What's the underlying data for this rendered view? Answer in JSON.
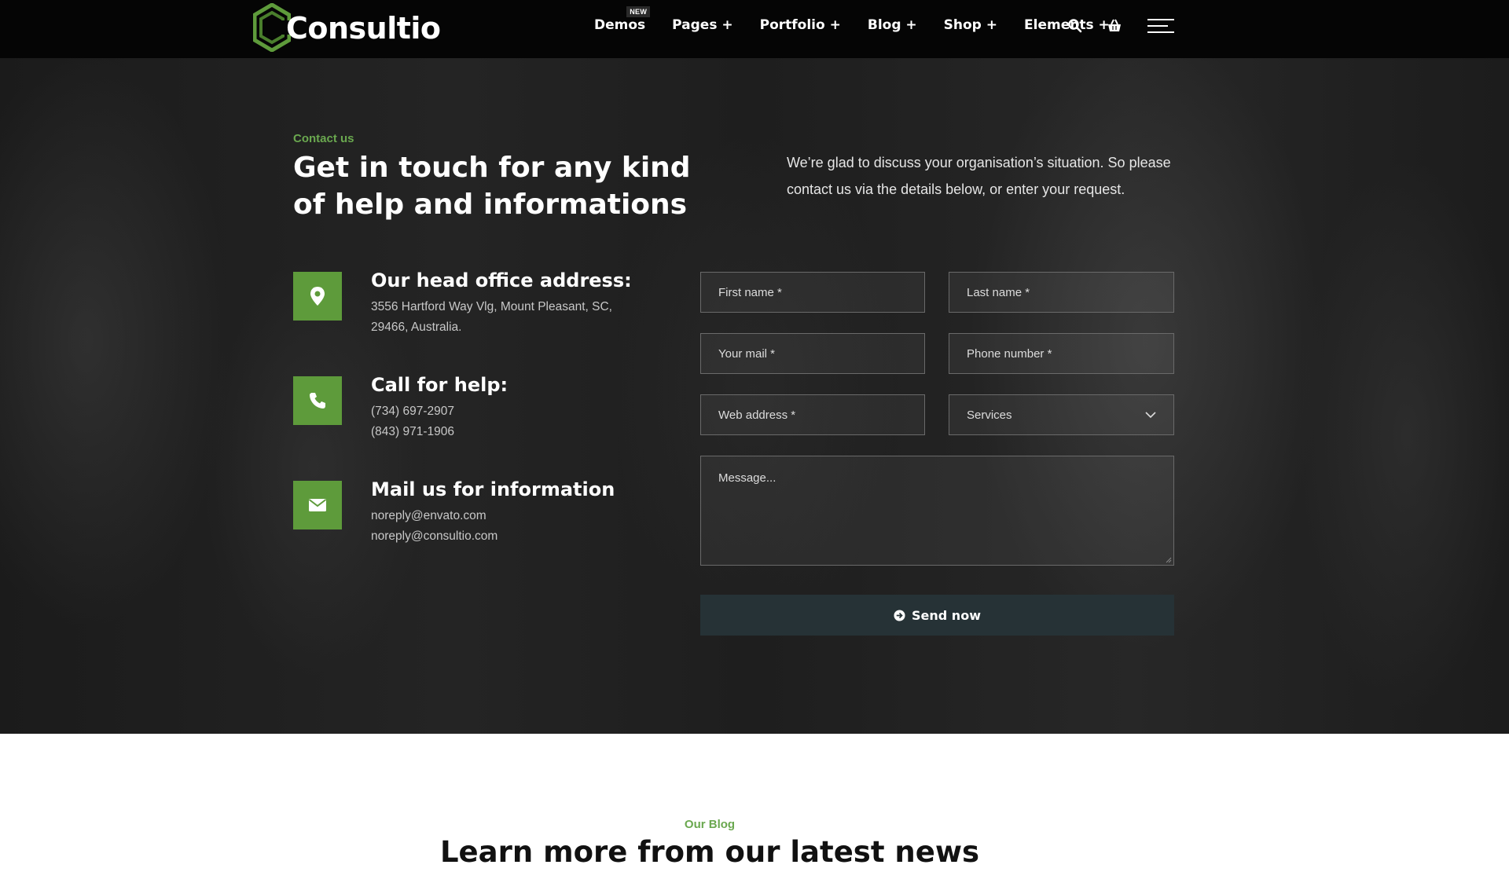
{
  "header": {
    "logo_text": "Consultio",
    "nav": [
      {
        "label": "Demos",
        "badge": "NEW"
      },
      {
        "label": "Pages +"
      },
      {
        "label": "Portfolio +"
      },
      {
        "label": "Blog +"
      },
      {
        "label": "Shop +"
      },
      {
        "label": "Elements +"
      }
    ],
    "icons": [
      "search-icon",
      "basket-icon",
      "hamburger-menu-icon"
    ]
  },
  "contact": {
    "eyebrow": "Contact us",
    "heading": "Get in touch for any kind of help and informations",
    "intro": "We’re glad to discuss your organisation’s situation. So please contact us via the details below, or enter your request.",
    "info": [
      {
        "icon": "map-pin-icon",
        "title": "Our head office address:",
        "lines": [
          "3556 Hartford Way Vlg, Mount Pleasant, SC,",
          "29466, Australia."
        ]
      },
      {
        "icon": "phone-icon",
        "title": "Call for help:",
        "lines": [
          "(734) 697-2907",
          "(843) 971-1906"
        ]
      },
      {
        "icon": "envelope-icon",
        "title": "Mail us for information",
        "lines": [
          "noreply@envato.com",
          "noreply@consultio.com"
        ]
      }
    ],
    "form": {
      "first_name": "First name *",
      "last_name": "Last name *",
      "email": "Your mail *",
      "phone": "Phone number *",
      "web": "Web address *",
      "services": "Services",
      "message": "Message...",
      "submit": "Send now"
    }
  },
  "blog": {
    "eyebrow": "Our Blog",
    "title": "Learn more from our latest news"
  },
  "colors": {
    "accent": "#5e9b3b",
    "header_bg": "#050505",
    "button_bg": "#263236"
  }
}
